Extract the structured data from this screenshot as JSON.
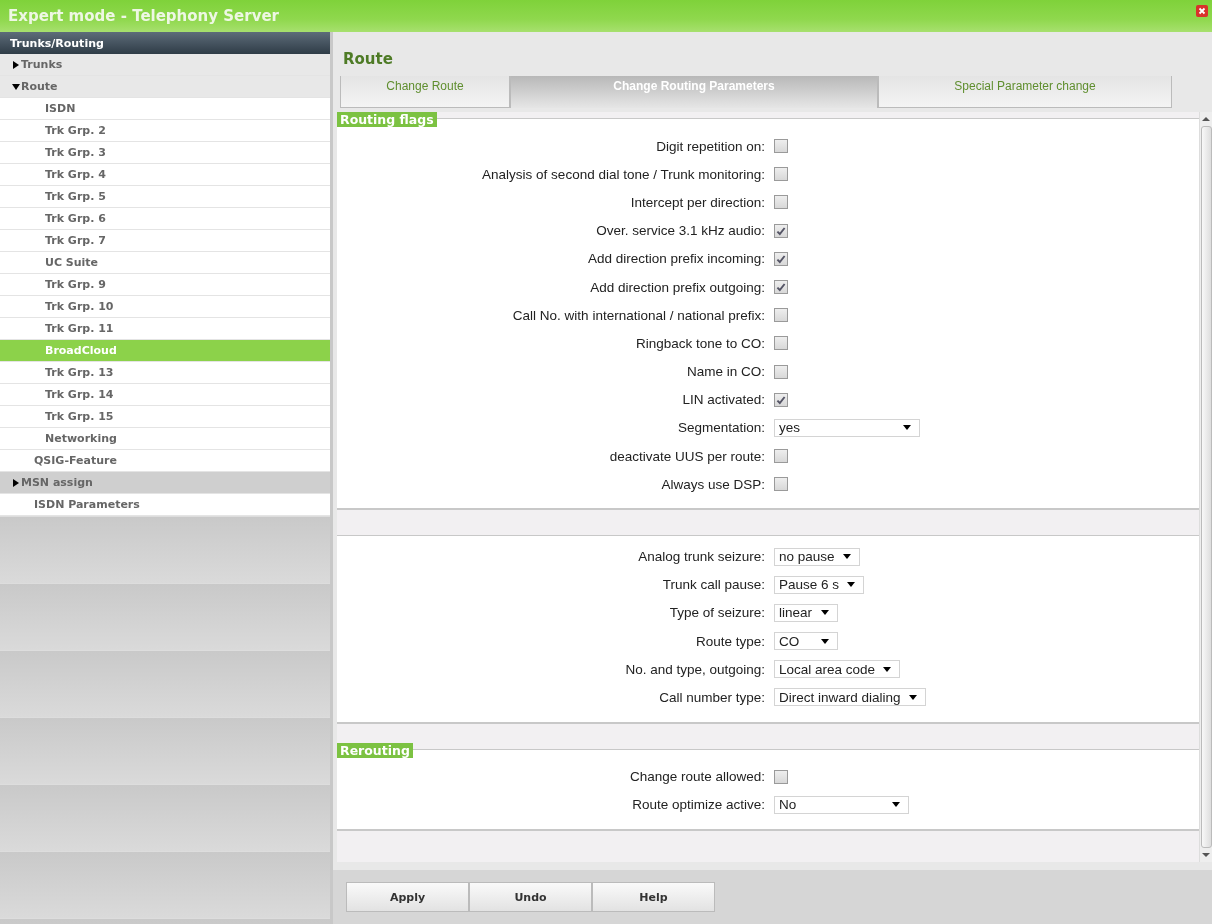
{
  "window": {
    "title": "Expert mode - Telephony Server"
  },
  "sidebar": {
    "header": "Trunks/Routing",
    "items": [
      {
        "label": "Trunks",
        "kind": "folder",
        "expanded": false,
        "selected": false
      },
      {
        "label": "Route",
        "kind": "folder",
        "expanded": true,
        "selected": false,
        "children": [
          {
            "label": "ISDN",
            "selected": false
          },
          {
            "label": "Trk Grp. 2",
            "selected": false
          },
          {
            "label": "Trk Grp. 3",
            "selected": false
          },
          {
            "label": "Trk Grp. 4",
            "selected": false
          },
          {
            "label": "Trk Grp. 5",
            "selected": false
          },
          {
            "label": "Trk Grp. 6",
            "selected": false
          },
          {
            "label": "Trk Grp. 7",
            "selected": false
          },
          {
            "label": "UC Suite",
            "selected": false
          },
          {
            "label": "Trk Grp. 9",
            "selected": false
          },
          {
            "label": "Trk Grp. 10",
            "selected": false
          },
          {
            "label": "Trk Grp. 11",
            "selected": false
          },
          {
            "label": "BroadCloud",
            "selected": true
          },
          {
            "label": "Trk Grp. 13",
            "selected": false
          },
          {
            "label": "Trk Grp. 14",
            "selected": false
          },
          {
            "label": "Trk Grp. 15",
            "selected": false
          },
          {
            "label": "Networking",
            "selected": false
          }
        ]
      },
      {
        "label": "QSIG-Feature",
        "kind": "leaf",
        "selected": false
      },
      {
        "label": "MSN assign",
        "kind": "folder",
        "expanded": false,
        "selected": false
      },
      {
        "label": "ISDN Parameters",
        "kind": "leaf",
        "selected": false
      }
    ]
  },
  "page": {
    "title": "Route",
    "tabs": [
      {
        "label": "Change Route",
        "selected": false
      },
      {
        "label": "Change Routing Parameters",
        "selected": true
      },
      {
        "label": "Special Parameter change",
        "selected": false
      }
    ],
    "sections": [
      {
        "legend": "Routing flags",
        "fields": [
          {
            "label": "Digit repetition on:",
            "kind": "checkbox",
            "checked": false
          },
          {
            "label": "Analysis of second dial tone / Trunk monitoring:",
            "kind": "checkbox",
            "checked": false
          },
          {
            "label": "Intercept per direction:",
            "kind": "checkbox",
            "checked": false
          },
          {
            "label": "Over. service 3.1 kHz audio:",
            "kind": "checkbox",
            "checked": true
          },
          {
            "label": "Add direction prefix incoming:",
            "kind": "checkbox",
            "checked": true
          },
          {
            "label": "Add direction prefix outgoing:",
            "kind": "checkbox",
            "checked": true
          },
          {
            "label": "Call No. with international / national prefix:",
            "kind": "checkbox",
            "checked": false
          },
          {
            "label": "Ringback tone to CO:",
            "kind": "checkbox",
            "checked": false
          },
          {
            "label": "Name in CO:",
            "kind": "checkbox",
            "checked": false
          },
          {
            "label": "LIN activated:",
            "kind": "checkbox",
            "checked": true
          },
          {
            "label": "Segmentation:",
            "kind": "select",
            "value": "yes"
          },
          {
            "label": "deactivate UUS per route:",
            "kind": "checkbox",
            "checked": false
          },
          {
            "label": "Always use DSP:",
            "kind": "checkbox",
            "checked": false
          }
        ]
      },
      {
        "fields": [
          {
            "label": "Analog trunk seizure:",
            "kind": "select",
            "value": "no pause"
          },
          {
            "label": "Trunk call pause:",
            "kind": "select",
            "value": "Pause 6 s"
          },
          {
            "label": "Type of seizure:",
            "kind": "select",
            "value": "linear"
          },
          {
            "label": "Route type:",
            "kind": "select",
            "value": "CO"
          },
          {
            "label": "No. and type, outgoing:",
            "kind": "select",
            "value": "Local area code"
          },
          {
            "label": "Call number type:",
            "kind": "select",
            "value": "Direct inward dialing"
          }
        ]
      },
      {
        "legend": "Rerouting",
        "fields": [
          {
            "label": "Change route allowed:",
            "kind": "checkbox",
            "checked": false
          },
          {
            "label": "Route optimize active:",
            "kind": "select",
            "value": "No"
          }
        ]
      }
    ]
  },
  "buttons": [
    "Apply",
    "Undo",
    "Help"
  ]
}
